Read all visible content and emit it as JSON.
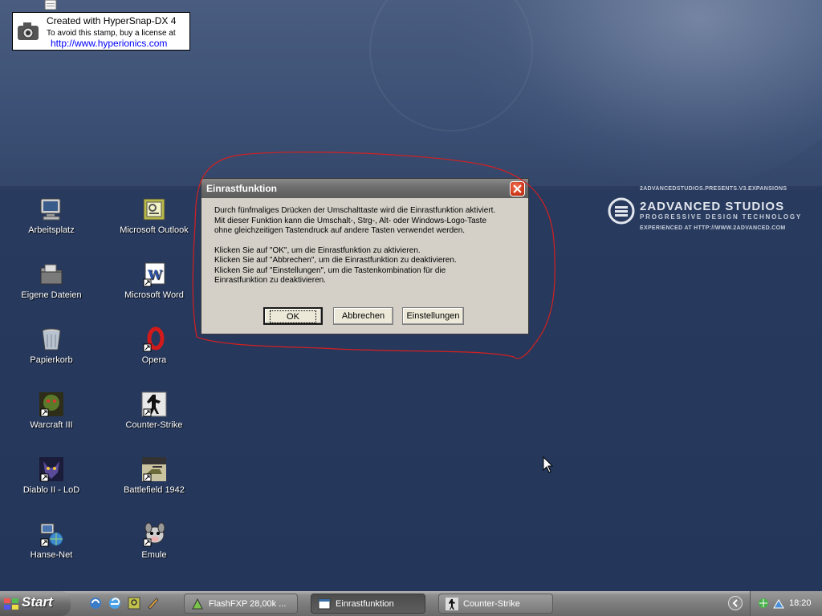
{
  "stamp": {
    "line1": "Created with HyperSnap-DX 4",
    "line2": "To avoid this stamp, buy a license at",
    "line3": "http://www.hyperionics.com"
  },
  "desktop_icons": [
    {
      "label": "Arbeitsplatz",
      "icon": "computer-icon"
    },
    {
      "label": "Microsoft Outlook",
      "icon": "outlook-icon"
    },
    {
      "label": "Eigene Dateien",
      "icon": "folder-icon"
    },
    {
      "label": "Microsoft Word",
      "icon": "word-icon"
    },
    {
      "label": "Papierkorb",
      "icon": "recycle-bin-icon"
    },
    {
      "label": "Opera",
      "icon": "opera-icon"
    },
    {
      "label": "Warcraft III",
      "icon": "warcraft-icon"
    },
    {
      "label": "Counter-Strike",
      "icon": "counter-strike-icon"
    },
    {
      "label": "Diablo II - LoD",
      "icon": "diablo-icon"
    },
    {
      "label": "Battlefield 1942",
      "icon": "battlefield-icon"
    },
    {
      "label": "Hanse-Net",
      "icon": "network-icon"
    },
    {
      "label": "Emule",
      "icon": "emule-icon"
    }
  ],
  "wallpaper_brand": {
    "presents": "2ADVANCEDSTUDIOS.PRESENTS.V3.EXPANSIONS",
    "name": "2ADVANCED STUDIOS",
    "tagline": "PROGRESSIVE DESIGN TECHNOLOGY",
    "url": "EXPERIENCED AT HTTP://WWW.2ADVANCED.COM"
  },
  "dialog": {
    "title": "Einrastfunktion",
    "paragraph1": "Durch fünfmaliges Drücken der Umschalttaste wird die Einrastfunktion aktiviert.\nMit dieser Funktion kann die Umschalt-, Strg-, Alt- oder Windows-Logo-Taste\nohne  gleichzeitigen Tastendruck auf andere Tasten verwendet werden.",
    "paragraph2": "Klicken Sie auf \"OK\", um die Einrastfunktion zu aktivieren.\nKlicken Sie auf \"Abbrechen\", um die Einrastfunktion zu deaktivieren.\nKlicken Sie auf \"Einstellungen\", um die Tastenkombination für die\nEinrastfunktion zu deaktivieren.",
    "ok_label": "OK",
    "cancel_label": "Abbrechen",
    "settings_label": "Einstellungen"
  },
  "taskbar": {
    "start_label": "Start",
    "tasks": [
      {
        "label": "FlashFXP 28,00k ...",
        "icon": "flashfxp-icon"
      },
      {
        "label": "Einrastfunktion",
        "icon": "window-icon",
        "active": true
      },
      {
        "label": "Counter-Strike",
        "icon": "counter-strike-icon"
      }
    ],
    "clock": "18:20"
  },
  "colors": {
    "desktop_bg": "#2b3b5e",
    "dialog_bg": "#d4d0c8",
    "annotation_red": "#d42020"
  }
}
